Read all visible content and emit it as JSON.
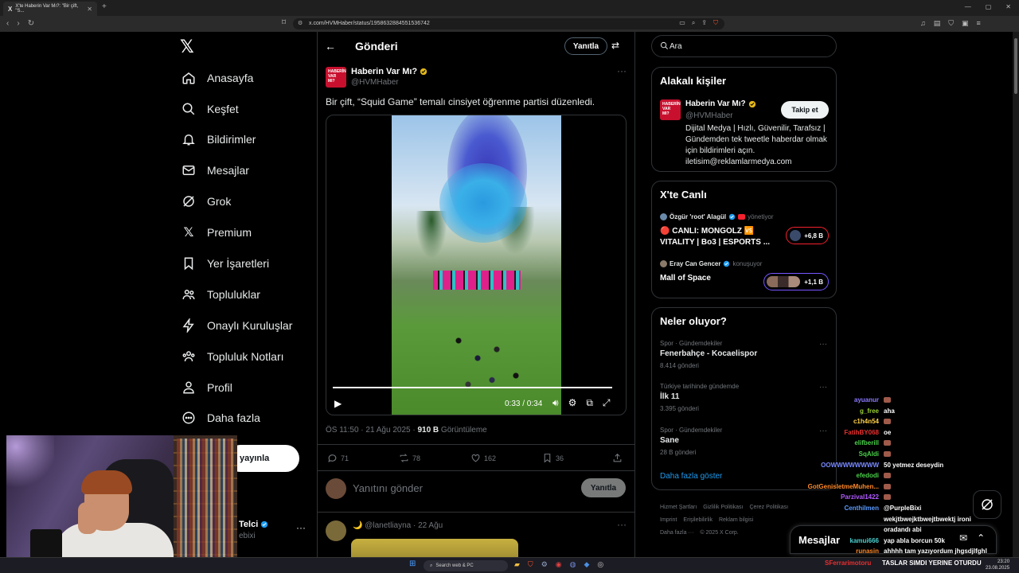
{
  "browser": {
    "tab_title": "X'te Haberin Var Mı?: \"Bir çift, \"S...",
    "url": "x.com/HVMHaber/status/1958632884551536742"
  },
  "nav": {
    "items": [
      "Anasayfa",
      "Keşfet",
      "Bildirimler",
      "Mesajlar",
      "Grok",
      "Premium",
      "Yer İşaretleri",
      "Topluluklar",
      "Onaylı Kuruluşlar",
      "Topluluk Notları",
      "Profil",
      "Daha fazla"
    ],
    "post_button": "yayınla",
    "profile_name": "Telci",
    "profile_handle": "ebixi"
  },
  "post": {
    "header_title": "Gönderi",
    "reply_button": "Yanıtla",
    "author_name": "Haberin Var Mı?",
    "author_handle": "@HVMHaber",
    "avatar_text": "HABERİN VAR MI?",
    "text": "Bir çift, “Squid Game” temalı cinsiyet öğrenme partisi düzenledi.",
    "video_time": "0:33 / 0:34",
    "video_progress": 0.97,
    "time": "ÖS 11:50 · 21 Ağu 2025 · ",
    "views": "910 B",
    "views_label": " Görüntüleme",
    "stats": {
      "replies": "71",
      "reposts": "78",
      "likes": "162",
      "bookmarks": "36"
    },
    "reply_placeholder": "Yanıtını gönder",
    "reply_send": "Yanıtla"
  },
  "reply2": {
    "handle": "🌙 @lanetliayna · 22 Ağu"
  },
  "sidebar": {
    "search_placeholder": "Ara",
    "related_title": "Alakalı kişiler",
    "related_name": "Haberin Var Mı?",
    "related_handle": "@HVMHaber",
    "follow_button": "Takip et",
    "related_bio": "Dijital Medya | Hızlı, Güvenilir, Tarafsız | Gündemden tek tweetle haberdar olmak için bildirimleri açın. iletisim@reklamlarmedya.com",
    "live_title": "X'te Canlı",
    "live": [
      {
        "host": "Özgür 'root' Alagül",
        "status": "yönetiyor",
        "title_line1": "🔴 CANLI: MONGOLZ 🆚",
        "title_line2": "VITALITY | Bo3 | ESPORTS ...",
        "count": "+6,8 B",
        "accent": "#f4212e"
      },
      {
        "host": "Eray Can Gencer",
        "status": "konuşuyor",
        "title_line1": "Mall of Space",
        "title_line2": "",
        "count": "+1,1 B",
        "accent": "#7856ff"
      }
    ],
    "trends_title": "Neler oluyor?",
    "trends": [
      {
        "cat": "Spor · Gündemdekiler",
        "name": "Fenerbahçe - Kocaelispor",
        "count": "8.414 gönderi"
      },
      {
        "cat": "Türkiye tarihinde gündemde",
        "name": "İlk 11",
        "count": "3.395 gönderi"
      },
      {
        "cat": "Spor · Gündemdekiler",
        "name": "Sane",
        "count": "28 B gönderi"
      }
    ],
    "show_more": "Daha fazla göster",
    "footer": [
      "Hizmet Şartları",
      "Gizlilik Politikası",
      "Çerez Politikası",
      "Imprint",
      "Erişilebilirlik",
      "Reklam bilgisi",
      "Daha fazla ···",
      "© 2025 X Corp."
    ]
  },
  "messages_drawer": "Mesajlar",
  "chat": [
    {
      "user": "ayuanur",
      "text": "",
      "color": "#8a7aff"
    },
    {
      "user": "g_free",
      "text": "aha",
      "color": "#9acd32"
    },
    {
      "user": "c1h4n54",
      "text": "",
      "color": "#ffd24a"
    },
    {
      "user": "FatihBY068",
      "text": "oe",
      "color": "#e83030"
    },
    {
      "user": "elifberill",
      "text": "",
      "color": "#4ad04a"
    },
    {
      "user": "SqAldi",
      "text": "",
      "color": "#4ad04a"
    },
    {
      "user": "OOWWWWWWWW",
      "text": "50 yetmez deseydin",
      "color": "#7a8aff"
    },
    {
      "user": "efedodi",
      "text": "",
      "color": "#4ad04a"
    },
    {
      "user": "GotGenisletmeMuhen...",
      "text": "",
      "color": "#ff8a2a"
    },
    {
      "user": "Parzival1422",
      "text": "",
      "color": "#b05aff"
    },
    {
      "user": "Centhilmen",
      "text": "@PurpleBixi",
      "color": "#5a9aff"
    },
    {
      "user": "",
      "text": "wekjtbwejktbwejtbwektj ironi",
      "color": "#fff"
    },
    {
      "user": "",
      "text": "oradandı abi",
      "color": "#fff"
    },
    {
      "user": "kamui666",
      "text": "yap abla borcun 50k",
      "color": "#4ad0d0"
    },
    {
      "user": "runasin",
      "text": "ahhhh tam yazıyordum jhgsdjlfghl",
      "color": "#ff8a2a"
    }
  ],
  "ticker": {
    "user": "SFerrarimotoru",
    "text": "TASLAR SIMDI YERINE OTURDU"
  },
  "taskbar": {
    "search": "Search web & PC",
    "time": "23:20",
    "date": "23.08.2025"
  }
}
